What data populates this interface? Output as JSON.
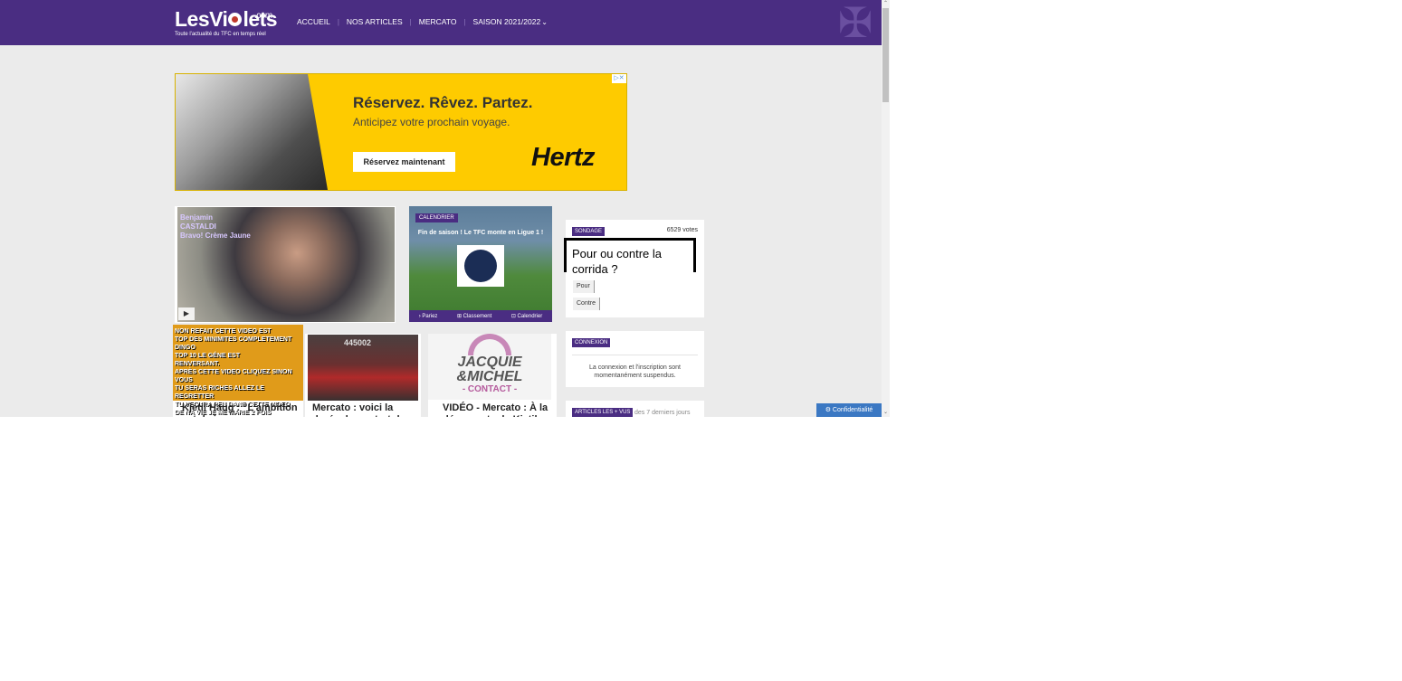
{
  "site": {
    "logo_main_left": "LesVi",
    "logo_main_right": "lets",
    "logo_com": ".com",
    "logo_tagline": "Toute l'actualité du TFC en temps réel"
  },
  "nav": {
    "items": [
      "ACCUEIL",
      "NOS ARTICLES",
      "MERCATO",
      "SAISON 2021/2022"
    ],
    "separator": "|",
    "dropdown_glyph": "⌄"
  },
  "ad": {
    "title": "Réservez. Rêvez. Partez.",
    "subtitle": "Anticipez votre prochain voyage.",
    "button": "Réservez maintenant",
    "brand": "Hertz",
    "adchoices": "▷✕"
  },
  "video": {
    "overlay_lines": [
      "Benjamin",
      "CASTALDI",
      "Bravo! Crème Jaune"
    ],
    "play_glyph": "▶"
  },
  "calendar": {
    "badge": "CALENDRIER",
    "headline": "Fin de saison ! Le TFC monte en Ligue 1 !",
    "links": [
      "› Pariez",
      "⊞ Classement",
      "⊡ Calendrier"
    ]
  },
  "poll": {
    "badge": "SONDAGE",
    "votes": "6529 votes",
    "question": "Pour ou contre la corrida ?",
    "options": [
      "Pour",
      "Contre"
    ]
  },
  "login": {
    "badge": "CONNEXION",
    "message": "La connexion et l'inscription sont momentanément suspendus."
  },
  "top_articles": {
    "badge": "ARTICLES LES + VUS",
    "subtitle": "des 7 derniers jours"
  },
  "articles": [
    {
      "title": "Kjetil Haug : \"L'ambition est de jouer",
      "image_text": [
        "NON REFAIT  CETTE VIDEO EST",
        "TOP DES MINIMITES COMPLETEMENT DINGO",
        "TOP 10 LE GÉNE EST",
        "RENVERSANT.",
        "APRÈS CETTE VIDEO  CLIQUEZ SINON VOUS",
        "TU SERAS RICHES  ALLEZ LE REGRETTER",
        "TU VECURA PEU  DANS CETTE VIDEO",
        "DE NA VIE  JE ME MARIE 2 FOIS"
      ]
    },
    {
      "title": "Mercato : voici la durée du contrat de Kjetil",
      "image_text": "445002"
    },
    {
      "title": "VIDÉO - Mercato : À la découverte de Kjetil",
      "image_text": [
        "JACQUIE",
        "&MICHEL",
        "- CONTACT -"
      ]
    }
  ],
  "privacy": {
    "label": "Confidentialité"
  },
  "scrollbar": {
    "up": "⌃",
    "down": "⌄"
  }
}
